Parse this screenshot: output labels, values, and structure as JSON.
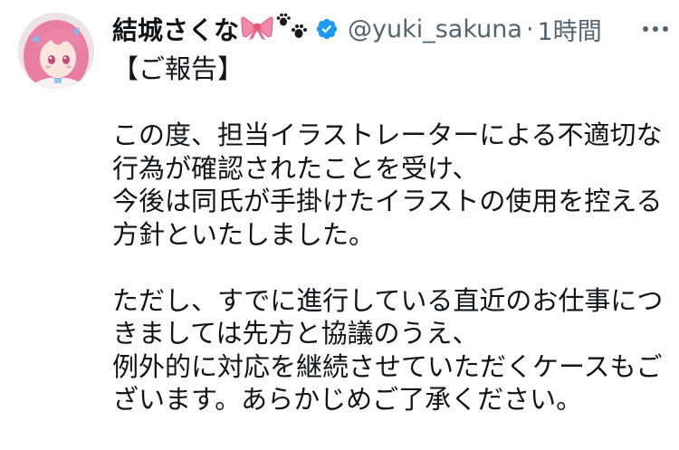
{
  "tweet": {
    "author": {
      "display_name": "結城さくな",
      "emoji_icons": [
        "ribbon-emoji",
        "paw-prints-emoji"
      ],
      "verified_icon": "verified-badge-icon",
      "handle": "@yuki_sakuna",
      "separator": "·",
      "time": "1時間",
      "avatar_icon": "avatar"
    },
    "more_icon": "more-options-icon",
    "colors": {
      "text": "#0f1419",
      "secondary": "#536471",
      "verified": "#1d9bf0",
      "ribbon": "#f08aa8"
    },
    "body_lines": [
      "【ご報告】",
      "",
      "この度、担当イラストレーターによる不適切な",
      "行為が確認されたことを受け、",
      "今後は同氏が手掛けたイラストの使用を控える",
      "方針といたしました。",
      "",
      "ただし、すでに進行している直近のお仕事につ",
      "きましては先方と協議のうえ、",
      "例外的に対応を継続させていただくケースもご",
      "ざいます。あらかじめご了承ください。"
    ]
  }
}
